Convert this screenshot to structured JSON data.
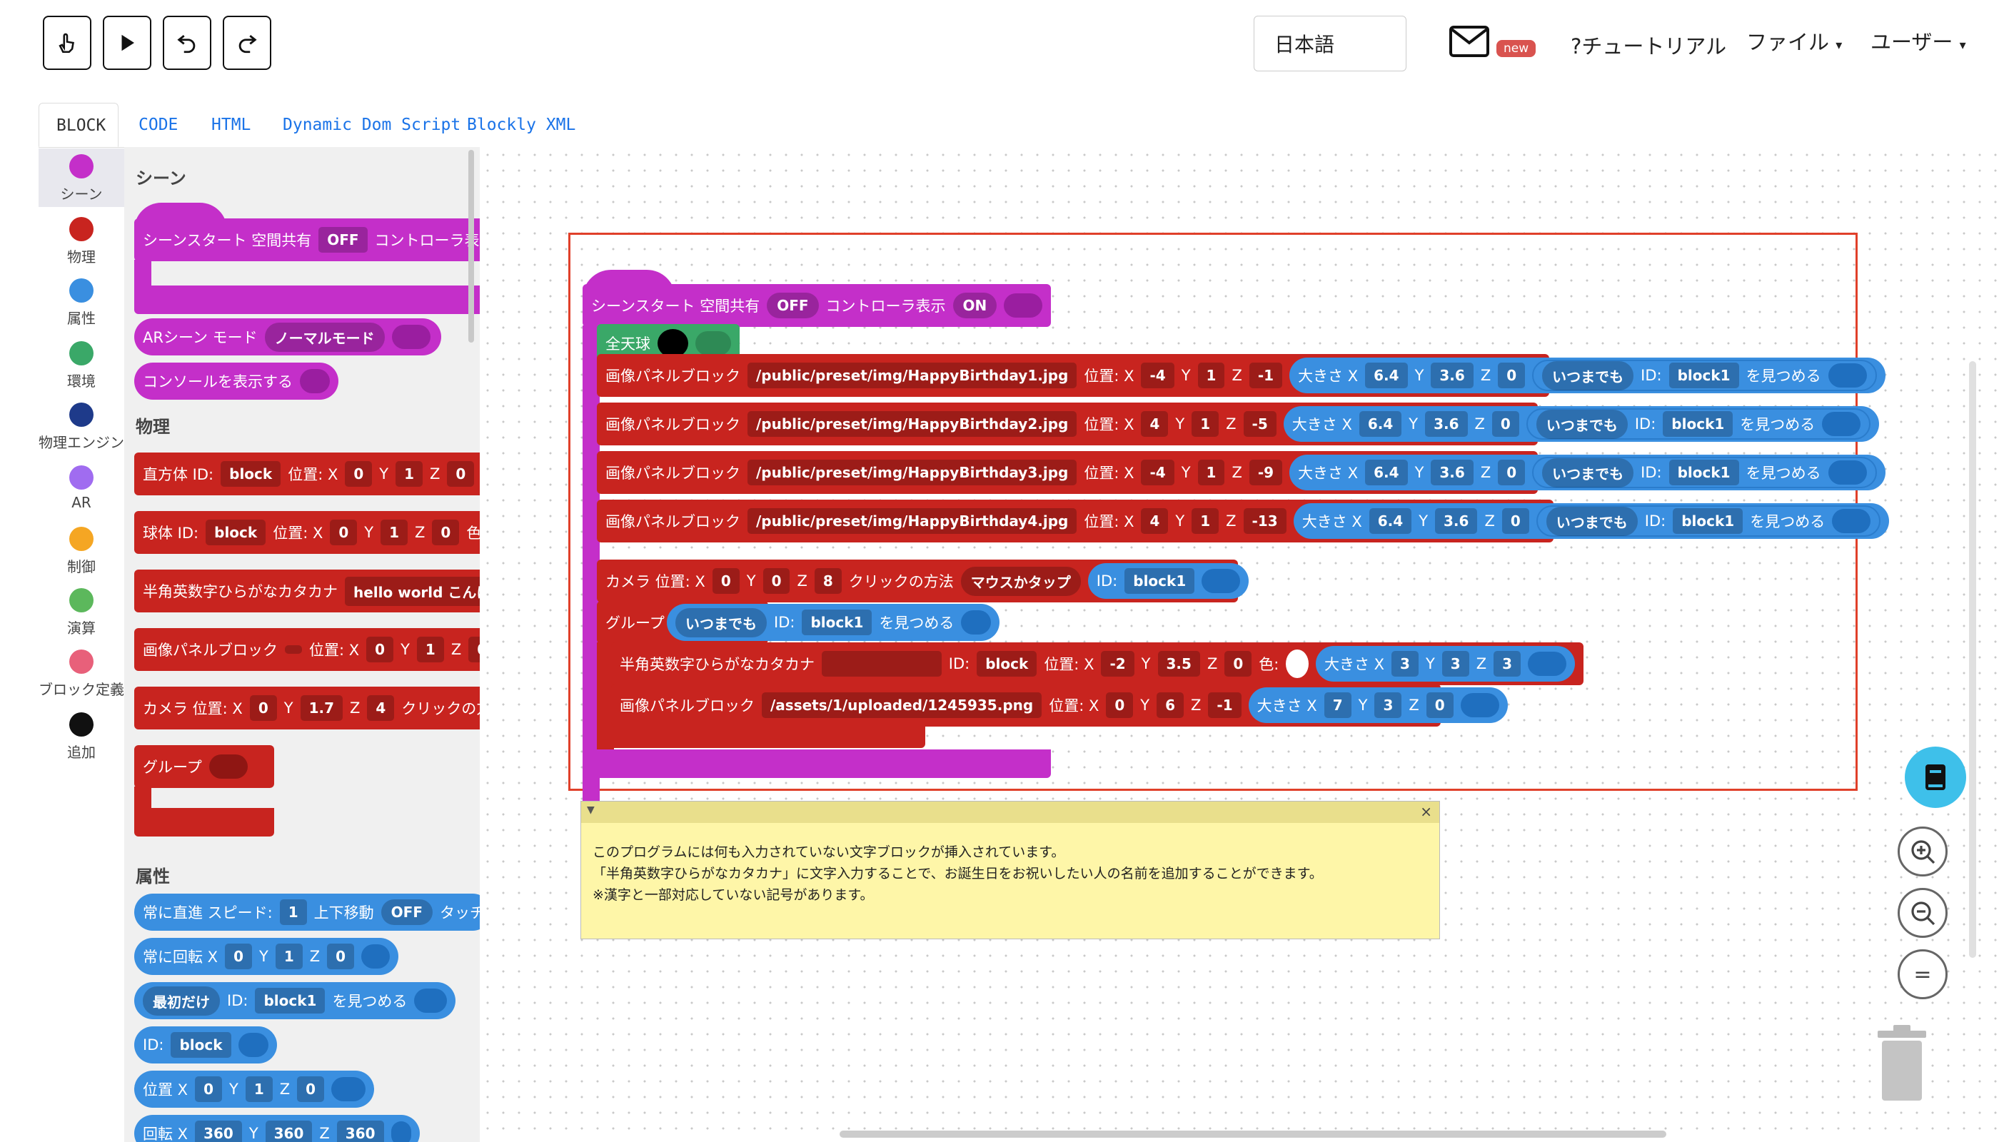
{
  "toolbar": {
    "language": "日本語",
    "badge_new": "new",
    "tutorial": "?チュートリアル",
    "file_menu": "ファイル",
    "user_menu": "ユーザー"
  },
  "tabs": [
    "BLOCK",
    "CODE",
    "HTML",
    "Dynamic Dom Script",
    "Blockly XML"
  ],
  "categories": [
    {
      "label": "シーン",
      "color": "#c42fc9"
    },
    {
      "label": "物理",
      "color": "#c8241f"
    },
    {
      "label": "属性",
      "color": "#3a8fe0"
    },
    {
      "label": "環境",
      "color": "#3aa868"
    },
    {
      "label": "物理エンジン",
      "color": "#1e3a8a"
    },
    {
      "label": "AR",
      "color": "#a06cf0"
    },
    {
      "label": "制御",
      "color": "#f5a623"
    },
    {
      "label": "演算",
      "color": "#5cb85c"
    },
    {
      "label": "ブロック定義",
      "color": "#e8607a"
    },
    {
      "label": "追加",
      "color": "#111111"
    }
  ],
  "flyout": {
    "scene_heading": "シーン",
    "scene_start": "シーンスタート 空間共有",
    "off": "OFF",
    "controller_show_partial": "コントローラ表示",
    "ar_scene": "ARシーン モード",
    "normal_mode": "ノーマルモード",
    "console_show": "コンソールを表示する",
    "physics_heading": "物理",
    "cube": "直方体 ID:",
    "block": "block",
    "pos": "位置: X",
    "y": "Y",
    "z": "Z",
    "zero": "0",
    "one": "1",
    "color": "色:",
    "sphere": "球体 ID:",
    "text_block": "半角英数字ひらがなカタカナ",
    "hello": "hello world こんにちは",
    "image_panel": "画像パネルブロック",
    "camera": "カメラ 位置: X",
    "cam_y": "1.7",
    "cam_z": "4",
    "click_method": "クリックの方法",
    "group": "グループ",
    "attr_heading": "属性",
    "always_forward": "常に直進 スピード:",
    "updown": "上下移動",
    "touch": "タッチ",
    "always_rotate": "常に回転 X",
    "first_only": "最初だけ",
    "id": "ID:",
    "block1": "block1",
    "look": "を見つめる",
    "position": "位置 X",
    "rotate": "回転 X",
    "r360": "360"
  },
  "workspace": {
    "scene_start": "シーンスタート 空間共有",
    "off": "OFF",
    "controller": "コントローラ表示",
    "on": "ON",
    "sky": "全天球",
    "image_panel": "画像パネルブロック",
    "pos": "位置: X",
    "size": "大きさ X",
    "always": "いつまでも",
    "id": "ID:",
    "look": "を見つめる",
    "y": "Y",
    "z": "Z",
    "panels": [
      {
        "path": "/public/preset/img/HappyBirthday1.jpg",
        "x": "-4",
        "y": "1",
        "z": "-1",
        "sx": "6.4",
        "sy": "3.6",
        "sz": "0",
        "target": "block1"
      },
      {
        "path": "/public/preset/img/HappyBirthday2.jpg",
        "x": "4",
        "y": "1",
        "z": "-5",
        "sx": "6.4",
        "sy": "3.6",
        "sz": "0",
        "target": "block1"
      },
      {
        "path": "/public/preset/img/HappyBirthday3.jpg",
        "x": "-4",
        "y": "1",
        "z": "-9",
        "sx": "6.4",
        "sy": "3.6",
        "sz": "0",
        "target": "block1"
      },
      {
        "path": "/public/preset/img/HappyBirthday4.jpg",
        "x": "4",
        "y": "1",
        "z": "-13",
        "sx": "6.4",
        "sy": "3.6",
        "sz": "0",
        "target": "block1"
      }
    ],
    "camera": "カメラ 位置: X",
    "cam_x": "0",
    "cam_y": "0",
    "cam_z": "8",
    "click_method": "クリックの方法",
    "mouse_tap": "マウスかタップ",
    "cam_target": "block1",
    "group": "グループ",
    "group_target": "block1",
    "text_block": "半角英数字ひらがなカタカナ",
    "text_id": "block",
    "text_x": "-2",
    "text_y": "3.5",
    "text_z": "0",
    "color": "色:",
    "text_sx": "3",
    "text_sy": "3",
    "text_sz": "3",
    "img2_path": "/assets/1/uploaded/1245935.png",
    "img2_x": "0",
    "img2_y": "6",
    "img2_z": "-1",
    "img2_sx": "7",
    "img2_sy": "3",
    "img2_sz": "0"
  },
  "comment": {
    "line1": "このプログラムには何も入力されていない文字ブロックが挿入されています。",
    "line2": "「半角英数字ひらがなカタカナ」に文字入力することで、お誕生日をお祝いしたい人の名前を追加することができます。",
    "line3": "※漢字と一部対応していない記号があります。"
  },
  "controls": {
    "reset": "="
  }
}
